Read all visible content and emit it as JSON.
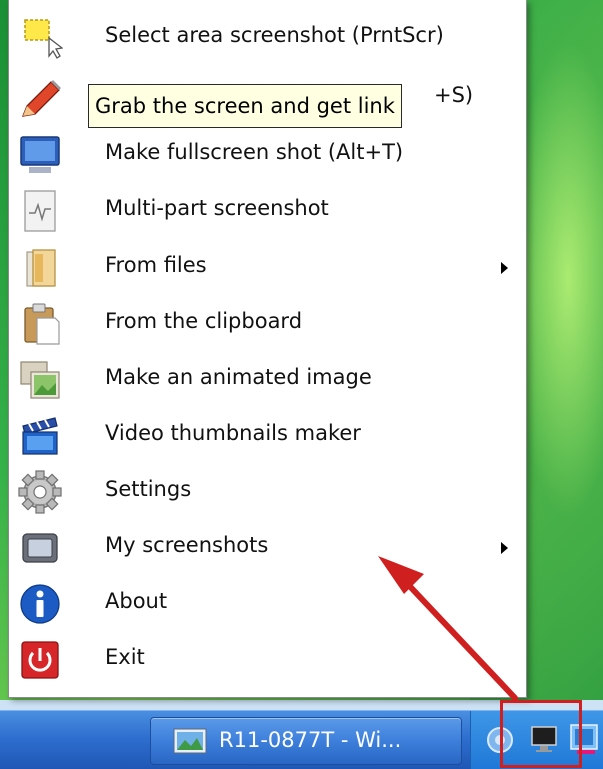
{
  "menu": {
    "items": [
      {
        "label": "Select area screenshot (PrntScr)",
        "icon": "select-area-icon",
        "submenu": false
      },
      {
        "label": "",
        "icon": "pencil-icon",
        "submenu": false
      },
      {
        "label": "Make fullscreen shot (Alt+T)",
        "icon": "monitor-icon",
        "submenu": false
      },
      {
        "label": "Multi-part screenshot",
        "icon": "multipart-document-icon",
        "submenu": false
      },
      {
        "label": "From files",
        "icon": "folder-files-icon",
        "submenu": true
      },
      {
        "label": "From the clipboard",
        "icon": "clipboard-icon",
        "submenu": false
      },
      {
        "label": "Make an animated image",
        "icon": "animated-image-icon",
        "submenu": false
      },
      {
        "label": "Video thumbnails maker",
        "icon": "clapperboard-icon",
        "submenu": false
      },
      {
        "label": "Settings",
        "icon": "gear-icon",
        "submenu": false
      },
      {
        "label": "My screenshots",
        "icon": "screenshots-window-icon",
        "submenu": true
      },
      {
        "label": "About",
        "icon": "info-icon",
        "submenu": false
      },
      {
        "label": "Exit",
        "icon": "power-icon",
        "submenu": false
      }
    ],
    "item1_tail": "+S)"
  },
  "tooltip": {
    "text": "Grab the screen and get link"
  },
  "taskbar": {
    "window_button_label": "R11-0877T - Wi...",
    "window_button_icon": "picture-viewer-icon",
    "tray_icons": [
      "volume-icon",
      "monitor-tray-icon",
      "app-tray-icon"
    ]
  },
  "annotation": {
    "highlight_color": "#d01f1f",
    "arrow_color": "#d01f1f"
  }
}
